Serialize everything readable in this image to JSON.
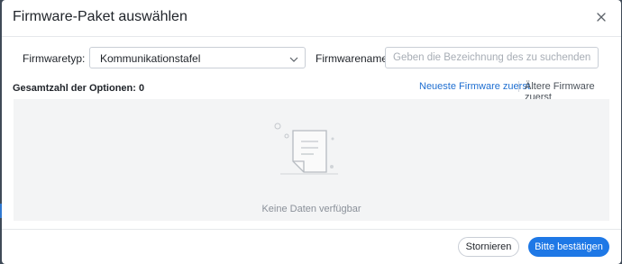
{
  "dialog": {
    "title": "Firmware-Paket auswählen",
    "close_icon": "close-icon"
  },
  "filters": {
    "type_label": "Firmwaretyp:",
    "type_value": "Kommunikationstafel",
    "name_label": "Firmwarename:",
    "name_value": "",
    "name_placeholder": "Geben die Bezeichnung des zu suchenden Firmwares ein"
  },
  "results": {
    "count_label": "Gesamtzahl der Optionen: 0",
    "sort_newest": "Neueste Firmware zuerst",
    "sort_oldest": "Ältere Firmware zuerst",
    "empty_text": "Keine Daten verfügbar",
    "empty_icon": "empty-document-icon"
  },
  "footer": {
    "cancel_label": "Stornieren",
    "confirm_label": "Bitte bestätigen"
  },
  "colors": {
    "accent": "#1e78e6",
    "link": "#1f6fd1",
    "empty_bg": "#f3f4f5"
  }
}
